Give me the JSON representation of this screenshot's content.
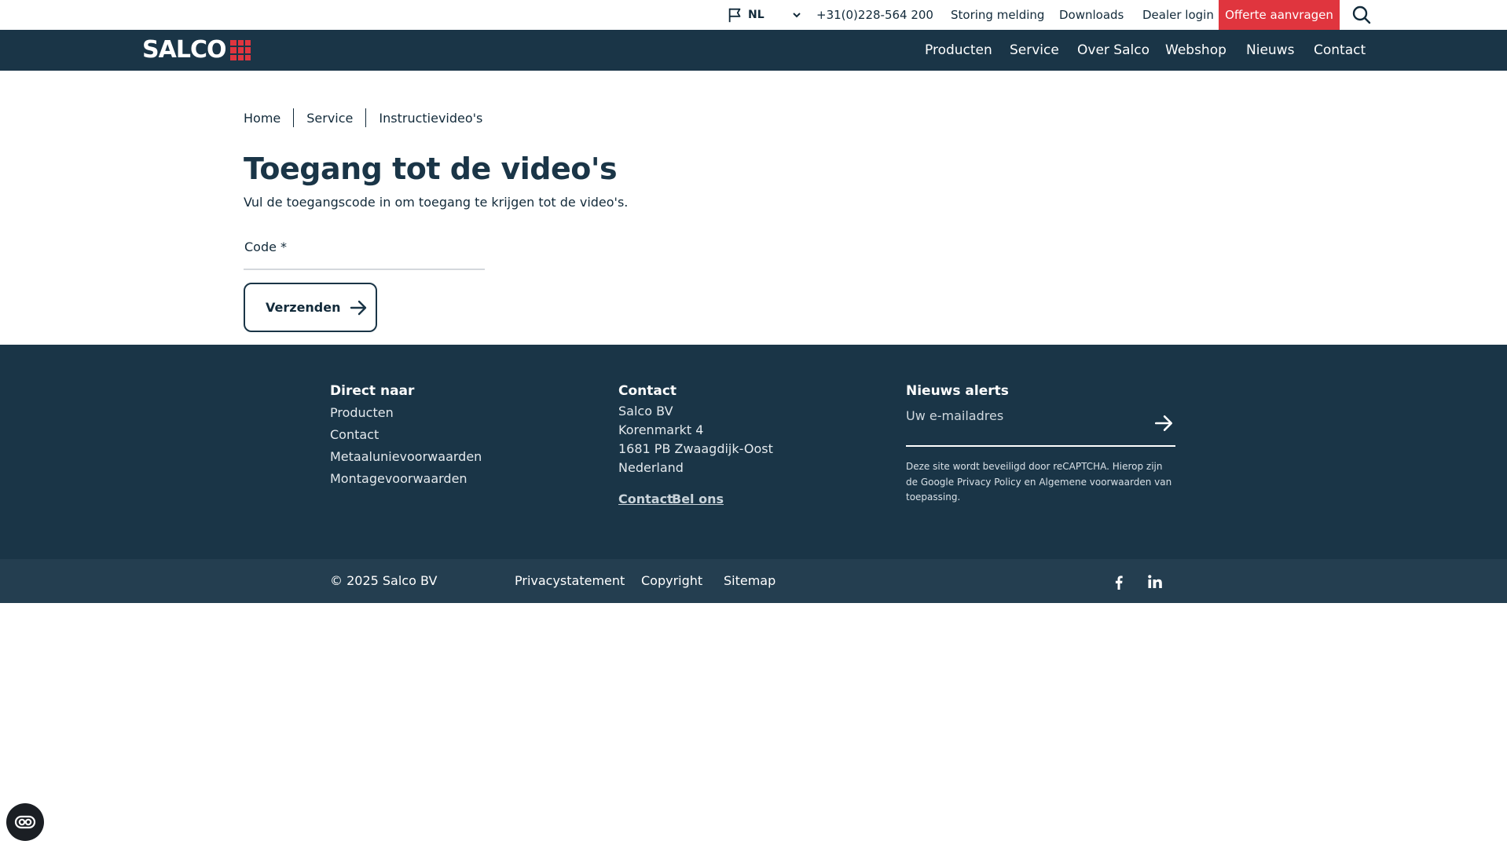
{
  "topbar": {
    "language": "NL",
    "phone": "+31(0)228-564 200",
    "links": [
      "Storing melding",
      "Downloads",
      "Dealer login"
    ],
    "cta": "Offerte aanvragen",
    "cta_color": "#e0353e"
  },
  "brand": {
    "name": "SALCO",
    "accent": "#e0353e",
    "nav_bg": "#1a3547"
  },
  "nav": [
    "Producten",
    "Service",
    "Over Salco",
    "Webshop",
    "Nieuws",
    "Contact"
  ],
  "breadcrumb": [
    "Home",
    "Service",
    "Instructievideo's"
  ],
  "main": {
    "title": "Toegang tot de video's",
    "intro": "Vul de toegangscode in om toegang te krijgen tot de video's.",
    "code_label": "Code *",
    "code_value": "",
    "submit_label": "Verzenden"
  },
  "footer": {
    "direct": {
      "title": "Direct naar",
      "links": [
        "Producten",
        "Contact",
        "Metaalunievoorwaarden",
        "Montagevoorwaarden"
      ]
    },
    "contact": {
      "title": "Contact",
      "lines": [
        "Salco BV",
        "Korenmarkt 4",
        "1681 PB Zwaagdijk-Oost",
        "Nederland"
      ],
      "links": [
        "Contact",
        "Bel ons"
      ]
    },
    "news": {
      "title": "Nieuws alerts",
      "email_placeholder": "Uw e-mailadres",
      "recaptcha": "Deze site wordt beveiligd door reCAPTCHA. Hierop zijn de Google Privacy Policy en Algemene voorwaarden van toepassing."
    }
  },
  "subfooter": {
    "copyright": "© 2025 Salco BV",
    "links": [
      "Privacystatement",
      "Copyright",
      "Sitemap"
    ],
    "social": [
      "facebook-icon",
      "linkedin-icon"
    ]
  },
  "icons": [
    "flag-icon",
    "chevron-down-icon",
    "search-icon",
    "arrow-right-icon",
    "accessibility-icon"
  ]
}
